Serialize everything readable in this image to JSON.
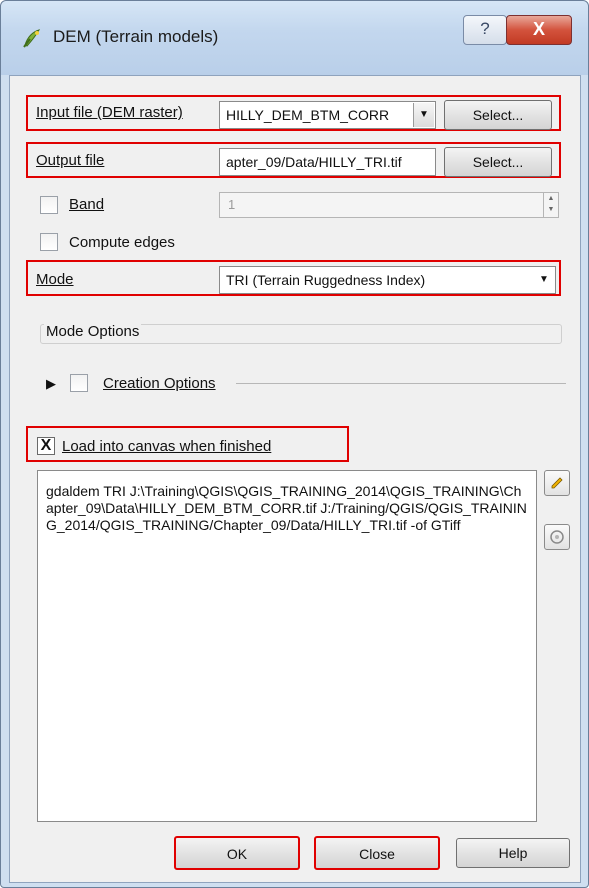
{
  "window": {
    "title": "DEM (Terrain models)",
    "help_label": "?",
    "close_label": "X"
  },
  "input_file": {
    "label": "Input file (DEM raster)",
    "value": "HILLY_DEM_BTM_CORR",
    "select_label": "Select..."
  },
  "output_file": {
    "label": "Output file",
    "value": "apter_09/Data/HILLY_TRI.tif",
    "select_label": "Select..."
  },
  "band": {
    "label": "Band",
    "value": "1",
    "checked": false
  },
  "compute_edges": {
    "label": "Compute edges",
    "checked": false
  },
  "mode": {
    "label": "Mode",
    "value": "TRI (Terrain Ruggedness Index)"
  },
  "mode_options": {
    "label": "Mode Options"
  },
  "creation_options": {
    "label": "Creation Options",
    "checked": false
  },
  "load_canvas": {
    "label": "Load into canvas when finished",
    "checked": true,
    "mark": "X"
  },
  "command": {
    "text": "gdaldem TRI J:\\Training\\QGIS\\QGIS_TRAINING_2014\\QGIS_TRAINING\\Chapter_09\\Data\\HILLY_DEM_BTM_CORR.tif J:/Training/QGIS/QGIS_TRAINING_2014/QGIS_TRAINING/Chapter_09/Data/HILLY_TRI.tif -of GTiff"
  },
  "buttons": {
    "ok": "OK",
    "close": "Close",
    "help": "Help"
  },
  "icons": {
    "app": "qgis-icon",
    "edit": "pencil-icon",
    "reset": "reset-icon",
    "expand": "triangle-right-icon"
  },
  "colors": {
    "highlight": "#e00000",
    "titlebar": "#c3d7ee",
    "close_button": "#c23a23"
  }
}
